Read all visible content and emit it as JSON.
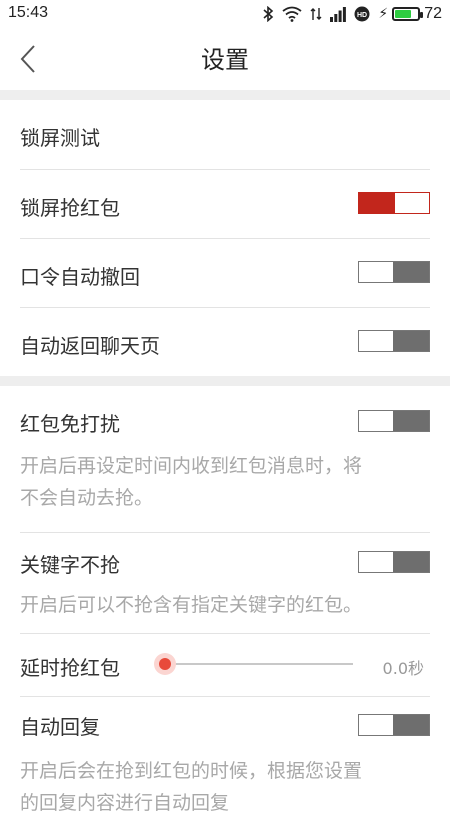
{
  "status_bar": {
    "time": "15:43",
    "battery_percent": "72",
    "battery_level": 0.72,
    "icons": [
      "bluetooth-icon",
      "wifi-icon",
      "4g-signal-icon",
      "signal-icon",
      "hd-icon",
      "charging-icon",
      "battery-icon"
    ]
  },
  "header": {
    "title": "设置",
    "back_icon": "chevron-left-icon"
  },
  "settings": {
    "lock_test": {
      "label": "锁屏测试"
    },
    "lock_grab": {
      "label": "锁屏抢红包",
      "on": true
    },
    "password_recall": {
      "label": "口令自动撤回",
      "on": false
    },
    "auto_return": {
      "label": "自动返回聊天页",
      "on": false
    },
    "dnd": {
      "label": "红包免打扰",
      "on": false,
      "desc_line1": "开启后再设定时间内收到红包消息时，将",
      "desc_line2": "不会自动去抢。"
    },
    "keyword": {
      "label": "关键字不抢",
      "on": false,
      "desc": "开启后可以不抢含有指定关键字的红包。"
    },
    "delay": {
      "label": "延时抢红包",
      "value": "0.0秒",
      "level": 0
    },
    "auto_reply": {
      "label": "自动回复",
      "on": false,
      "desc_line1": "开启后会在抢到红包的时候，根据您设置",
      "desc_line2": "的回复内容进行自动回复"
    }
  },
  "colors": {
    "accent": "#c2261c",
    "toggle_off": "#6e6e6e",
    "divider": "#e3e3e3",
    "section_gap": "#eeeeee",
    "description": "#a8a8a8"
  }
}
